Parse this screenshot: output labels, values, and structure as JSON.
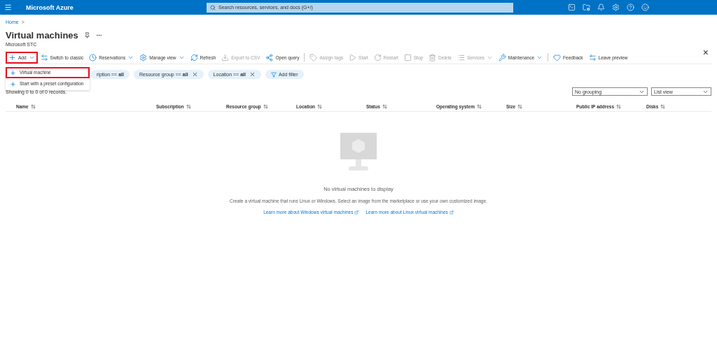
{
  "top_bar": {
    "brand": "Microsoft Azure",
    "search": {
      "placeholder": "Search resources, services, and docs (G+/)"
    }
  },
  "breadcrumb": [
    "Home",
    ">"
  ],
  "page": {
    "title": "Virtual machines",
    "subtitle": "Microsoft STC"
  },
  "toolbar": [
    {
      "label": "Add",
      "caret": true,
      "disabled": false,
      "highlighted": true
    },
    {
      "label": "Switch to classic",
      "caret": false,
      "disabled": false,
      "highlighted": false
    },
    {
      "label": "Reservations",
      "caret": true,
      "disabled": false,
      "highlighted": false
    },
    {
      "label": "Manage view",
      "caret": true,
      "disabled": false,
      "highlighted": false
    },
    {
      "label": "Refresh",
      "caret": false,
      "disabled": false,
      "highlighted": false
    },
    {
      "label": "Export to CSV",
      "caret": false,
      "disabled": true,
      "highlighted": false
    },
    {
      "label": "Open query",
      "caret": false,
      "disabled": false,
      "highlighted": false
    },
    {
      "label": "Assign tags",
      "caret": false,
      "disabled": true,
      "highlighted": false
    },
    {
      "label": "Start",
      "caret": false,
      "disabled": true,
      "highlighted": false
    },
    {
      "label": "Restart",
      "caret": false,
      "disabled": true,
      "highlighted": false
    },
    {
      "label": "Stop",
      "caret": false,
      "disabled": true,
      "highlighted": false
    },
    {
      "label": "Delete",
      "caret": false,
      "disabled": true,
      "highlighted": false
    },
    {
      "label": "Services",
      "caret": true,
      "disabled": true,
      "highlighted": false
    },
    {
      "label": "Maintenance",
      "caret": true,
      "disabled": false,
      "highlighted": false
    },
    {
      "label": "Feedback",
      "caret": false,
      "disabled": false,
      "highlighted": false
    },
    {
      "label": "Leave preview",
      "caret": false,
      "disabled": false,
      "highlighted": false
    }
  ],
  "add_menu": [
    {
      "label": "Virtual machine",
      "highlighted": true
    },
    {
      "label": "Start with a preset configuration",
      "highlighted": false
    }
  ],
  "filters": [
    {
      "label": "ription == **all**",
      "removable": false
    },
    {
      "label": "Resource group == **all**",
      "removable": true
    },
    {
      "label": "Location == **all**",
      "removable": true
    }
  ],
  "add_filter": "Add filter",
  "records": "Showing 0 to 0 of 0 records.",
  "grouping": "No grouping",
  "view": "List view",
  "columns": [
    "Name",
    "Subscription",
    "Resource group",
    "Location",
    "Status",
    "Operating system",
    "Size",
    "Public IP address",
    "Disks"
  ],
  "empty": {
    "title": "No virtual machines to display",
    "text": "Create a virtual machine that runs Linux or Windows. Select an image from the marketplace or use your own customized image.",
    "links": [
      "Learn more about Windows virtual machines",
      "Learn more about Linux virtual machines"
    ]
  },
  "close": "×"
}
